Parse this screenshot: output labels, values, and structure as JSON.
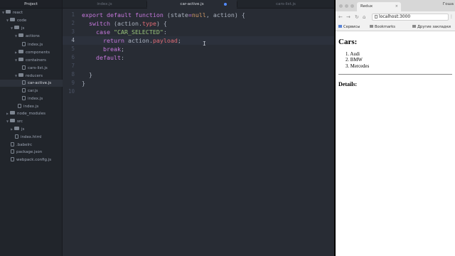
{
  "editor": {
    "tree": {
      "header": "Project",
      "items": [
        {
          "label": "react",
          "kind": "folder",
          "open": true
        },
        {
          "label": "code",
          "kind": "folder",
          "open": true
        },
        {
          "label": "js",
          "kind": "folder",
          "open": true
        },
        {
          "label": "actions",
          "kind": "folder",
          "open": true
        },
        {
          "label": "index.js",
          "kind": "file"
        },
        {
          "label": "components",
          "kind": "folder",
          "open": false
        },
        {
          "label": "containers",
          "kind": "folder",
          "open": true
        },
        {
          "label": "cars-list.js",
          "kind": "file"
        },
        {
          "label": "reducers",
          "kind": "folder",
          "open": true
        },
        {
          "label": "car-active.js",
          "kind": "file",
          "selected": true
        },
        {
          "label": "car.js",
          "kind": "file"
        },
        {
          "label": "index.js",
          "kind": "file"
        },
        {
          "label": "index.js",
          "kind": "file"
        },
        {
          "label": "node_modules",
          "kind": "folder",
          "open": false
        },
        {
          "label": "src",
          "kind": "folder",
          "open": true
        },
        {
          "label": "js",
          "kind": "folder",
          "open": false
        },
        {
          "label": "index.html",
          "kind": "file"
        },
        {
          "label": ".babelrc",
          "kind": "file"
        },
        {
          "label": "package.json",
          "kind": "file"
        },
        {
          "label": "webpack.config.js",
          "kind": "file"
        }
      ]
    },
    "tabs": [
      {
        "label": "index.js",
        "active": false
      },
      {
        "label": "car-active.js",
        "active": true
      },
      {
        "label": "cars-list.js",
        "active": false
      }
    ],
    "line_numbers": [
      "1",
      "2",
      "3",
      "4",
      "5",
      "6",
      "7",
      "8",
      "9",
      "10"
    ],
    "current_line": 4,
    "code": {
      "l1": {
        "a": "export",
        "b": " ",
        "c": "default",
        "d": " ",
        "e": "function",
        "f": " (",
        "g": "state",
        "h": "=",
        "i": "null",
        "j": ", ",
        "k": "action",
        "l": ") {"
      },
      "l2": {
        "a": "  switch",
        "b": " (",
        "c": "action",
        "d": ".",
        "e": "type",
        "f": ") {"
      },
      "l3": {
        "a": "    case",
        "b": " ",
        "c": "\"CAR_SELECTED\"",
        "d": ":"
      },
      "l4": {
        "a": "      return",
        "b": " ",
        "c": "action",
        "d": ".",
        "e": "payload",
        "f": ";"
      },
      "l5": {
        "a": "      break",
        "b": ";"
      },
      "l6": {
        "a": "    default",
        "b": ":"
      },
      "l7": {
        "a": "  }"
      },
      "l8": {
        "a": "}"
      }
    },
    "mouse_cursor": "I"
  },
  "browser": {
    "tab_title": "Redux",
    "tab_close": "×",
    "user_name": "Гоша",
    "nav": {
      "back": "←",
      "forward": "→",
      "reload": "↻",
      "home": "⌂"
    },
    "url": "localhost:3000",
    "menu": "⋮",
    "bookmarks": [
      {
        "label": "Сервисы",
        "icon": "apps-icon"
      },
      {
        "label": "Bookmarks",
        "icon": "folder-icon"
      },
      {
        "label": "Другие закладки",
        "icon": "folder-icon"
      }
    ],
    "page": {
      "heading": "Cars:",
      "cars": [
        "1. Audi",
        "2. BMW",
        "3. Mercedes"
      ],
      "details_heading": "Details:"
    }
  }
}
